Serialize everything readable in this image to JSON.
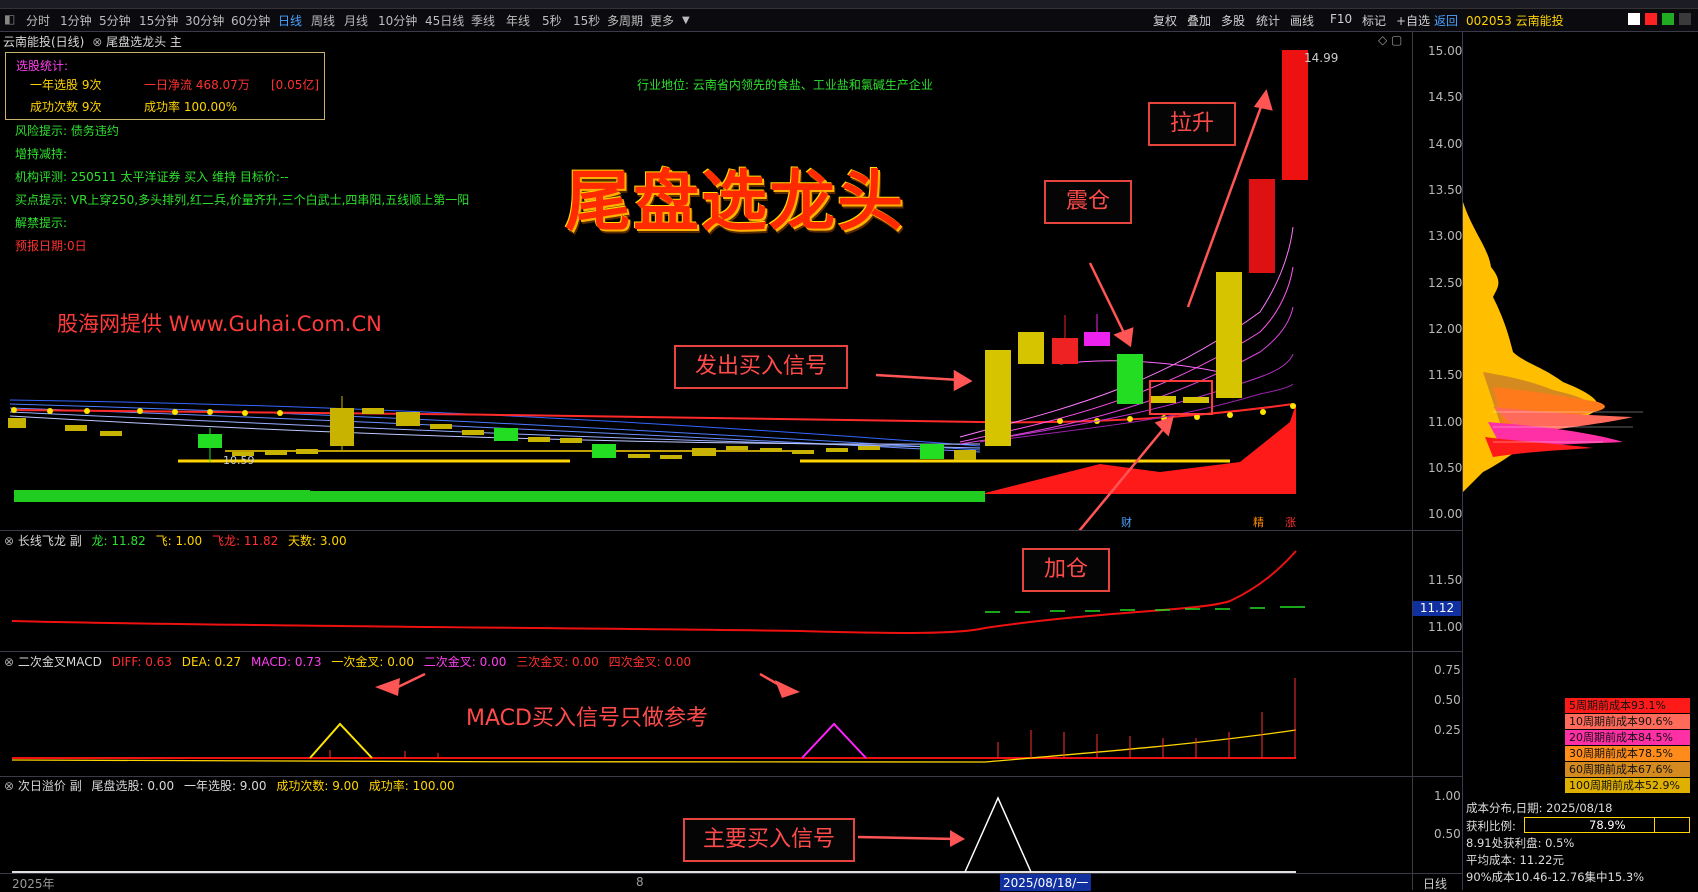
{
  "periods": [
    "分时",
    "1分钟",
    "5分钟",
    "15分钟",
    "30分钟",
    "60分钟",
    "日线",
    "周线",
    "月线",
    "10分钟",
    "45日线",
    "季线",
    "年线",
    "5秒",
    "15秒",
    "多周期",
    "更多"
  ],
  "active_period": "日线",
  "right_toolbar": [
    "复权",
    "叠加",
    "多股",
    "统计",
    "画线",
    "F10",
    "标记",
    "+自选",
    "返回"
  ],
  "stock_header": {
    "code_name": "002053 云南能投"
  },
  "main_title": {
    "stock": "云南能投(日线)",
    "indicator": "尾盘选龙头 主"
  },
  "stats": {
    "title": "选股统计:",
    "year_picks": "一年选股 9次",
    "net_inflow": "一日净流 468.07万",
    "net_inflow_yi": "[0.05亿]",
    "success_count": "成功次数 9次",
    "success_rate": "成功率 100.00%"
  },
  "info_lines": {
    "risk": "风险提示: 债务违约",
    "holding": "增持减持:",
    "rating": "机构评测: 250511 太平洋证券 买入 维持 目标价:--",
    "buypoint": "买点提示: VR上穿250,多头排列,红二兵,价量齐升,三个白武士,四串阳,五线顺上第一阳",
    "unlock": "解禁提示:",
    "report": "预报日期:0日"
  },
  "industry": "行业地位: 云南省内领先的食盐、工业盐和氯碱生产企业",
  "big_title": "尾盘选龙头",
  "watermark": "股海网提供 Www.Guhai.Com.CN",
  "annotations": {
    "lasheng": "拉升",
    "zhencang": "震仓",
    "buy_signal": "发出买入信号",
    "jiacang": "加仓",
    "macd_ref": "MACD买入信号只做参考",
    "main_buy": "主要买入信号"
  },
  "price_labels": {
    "high": "14.99",
    "low": "10.59"
  },
  "markers": {
    "cai": "财",
    "jing": "精",
    "zhang": "涨"
  },
  "main_axis": [
    "15.00",
    "14.50",
    "14.00",
    "13.50",
    "13.00",
    "12.50",
    "12.00",
    "11.50",
    "11.00",
    "10.50",
    "10.00"
  ],
  "panel2": {
    "title": "长线飞龙 副",
    "long": "龙: 11.82",
    "fly": "飞: 1.00",
    "flydragon": "飞龙: 11.82",
    "days": "天数: 3.00",
    "axis": [
      "11.50",
      "11.00"
    ],
    "current": "11.12"
  },
  "panel3": {
    "title": "二次金叉MACD",
    "diff": "DIFF: 0.63",
    "dea": "DEA: 0.27",
    "macd": "MACD: 0.73",
    "c1": "一次金叉: 0.00",
    "c2": "二次金叉: 0.00",
    "c3": "三次金叉: 0.00",
    "c4": "四次金叉: 0.00",
    "axis": [
      "0.75",
      "0.50",
      "0.25"
    ]
  },
  "panel4": {
    "title": "次日溢价 副",
    "pick": "尾盘选股: 0.00",
    "year": "一年选股: 9.00",
    "succ": "成功次数: 9.00",
    "rate": "成功率: 100.00",
    "axis": [
      "1.00",
      "0.50"
    ]
  },
  "bottom": {
    "year": "2025年",
    "month": "8",
    "date": "2025/08/18/一",
    "period": "日线"
  },
  "cost_periods": [
    {
      "label": "5周期前成本93.1%",
      "color": "#ff1a1a"
    },
    {
      "label": "10周期前成本90.6%",
      "color": "#ff6a5a"
    },
    {
      "label": "20周期前成本84.5%",
      "color": "#ff2fa6"
    },
    {
      "label": "30周期前成本78.5%",
      "color": "#ff8c1a"
    },
    {
      "label": "60周期前成本67.6%",
      "color": "#d48a1e"
    },
    {
      "label": "100周期前成本52.9%",
      "color": "#e0b000"
    }
  ],
  "cost_info": {
    "date": "成本分布,日期: 2025/08/18",
    "profit_label": "获利比例:",
    "profit_value": "78.9%",
    "profit_ratio": 0.789,
    "profit_disc": "8.91处获利盘: 0.5%",
    "avg_cost": "平均成本: 11.22元",
    "cost90": "90%成本10.46-12.76集中15.3%"
  }
}
